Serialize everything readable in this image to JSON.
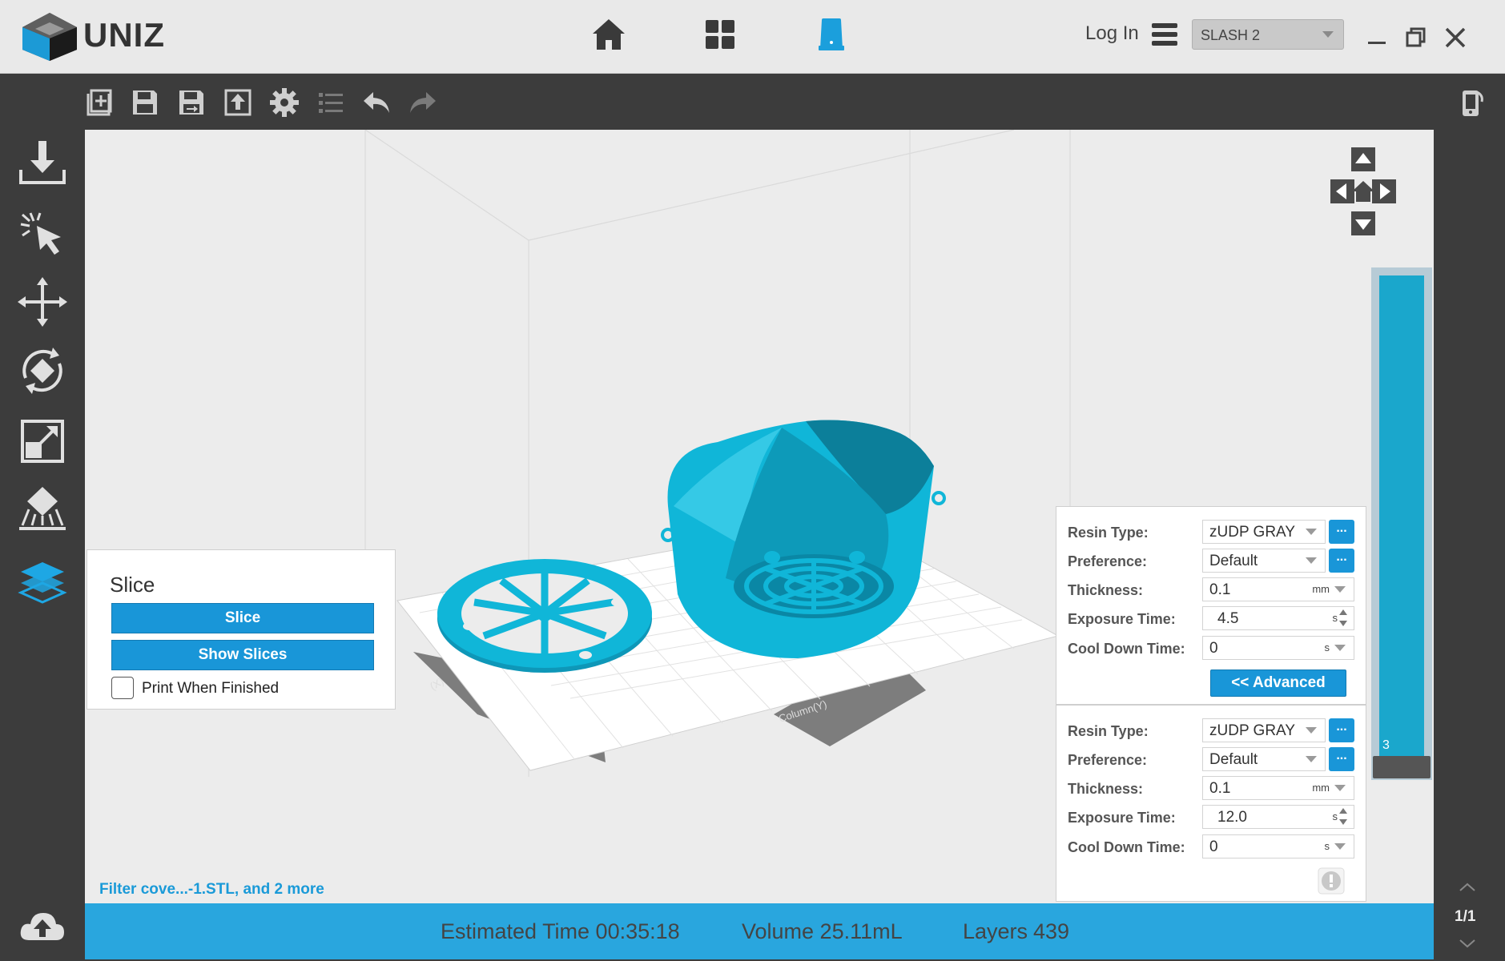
{
  "app": {
    "name": "UNIZ"
  },
  "header": {
    "nav_icons": [
      "home-icon",
      "grid-icon",
      "printer-icon"
    ],
    "login_label": "Log In",
    "printer_selected": "SLASH 2"
  },
  "toolbar": {
    "icons": [
      "add-file-icon",
      "save-icon",
      "save-as-icon",
      "export-icon",
      "settings-gear-icon",
      "list-icon",
      "undo-icon",
      "redo-icon"
    ]
  },
  "sidebar": {
    "icons": [
      "import-download-icon",
      "select-cursor-icon",
      "move-arrows-icon",
      "rotate-icon",
      "scale-icon",
      "support-icon",
      "layers-icon",
      "cloud-upload-icon"
    ]
  },
  "slice_panel": {
    "title": "Slice",
    "slice_button": "Slice",
    "show_slices_button": "Show Slices",
    "print_when_finished_label": "Print When Finished",
    "print_when_finished_checked": false
  },
  "settings_top": {
    "resin_type_label": "Resin Type:",
    "resin_type_value": "zUDP GRAY",
    "preference_label": "Preference:",
    "preference_value": "Default",
    "thickness_label": "Thickness:",
    "thickness_value": "0.1",
    "thickness_unit": "mm",
    "exposure_label": "Exposure Time:",
    "exposure_value": "4.5",
    "exposure_unit": "s",
    "cooldown_label": "Cool Down Time:",
    "cooldown_value": "0",
    "cooldown_unit": "s",
    "advanced_button": "<< Advanced",
    "dots_label": "..."
  },
  "settings_bottom": {
    "resin_type_label": "Resin Type:",
    "resin_type_value": "zUDP GRAY",
    "preference_label": "Preference:",
    "preference_value": "Default",
    "thickness_label": "Thickness:",
    "thickness_value": "0.1",
    "thickness_unit": "mm",
    "exposure_label": "Exposure Time:",
    "exposure_value": "12.0",
    "exposure_unit": "s",
    "cooldown_label": "Cool Down Time:",
    "cooldown_value": "0",
    "cooldown_unit": "s",
    "dots_label": "..."
  },
  "viewport": {
    "axis_label_y": "Column(Y)",
    "axis_label_x": "(X)"
  },
  "layer_slider": {
    "value_label": "3"
  },
  "files_label": "Filter cove...-1.STL, and 2 more",
  "status": {
    "estimated_time": "Estimated Time 00:35:18",
    "volume": "Volume 25.11mL",
    "layers_label": "Layers",
    "layers_value": "439"
  },
  "page_counter": "1/1",
  "colors": {
    "accent": "#1996d8",
    "model": "#10b6d8",
    "statusbar": "#29a6de",
    "chrome_dark": "#3c3c3c"
  }
}
